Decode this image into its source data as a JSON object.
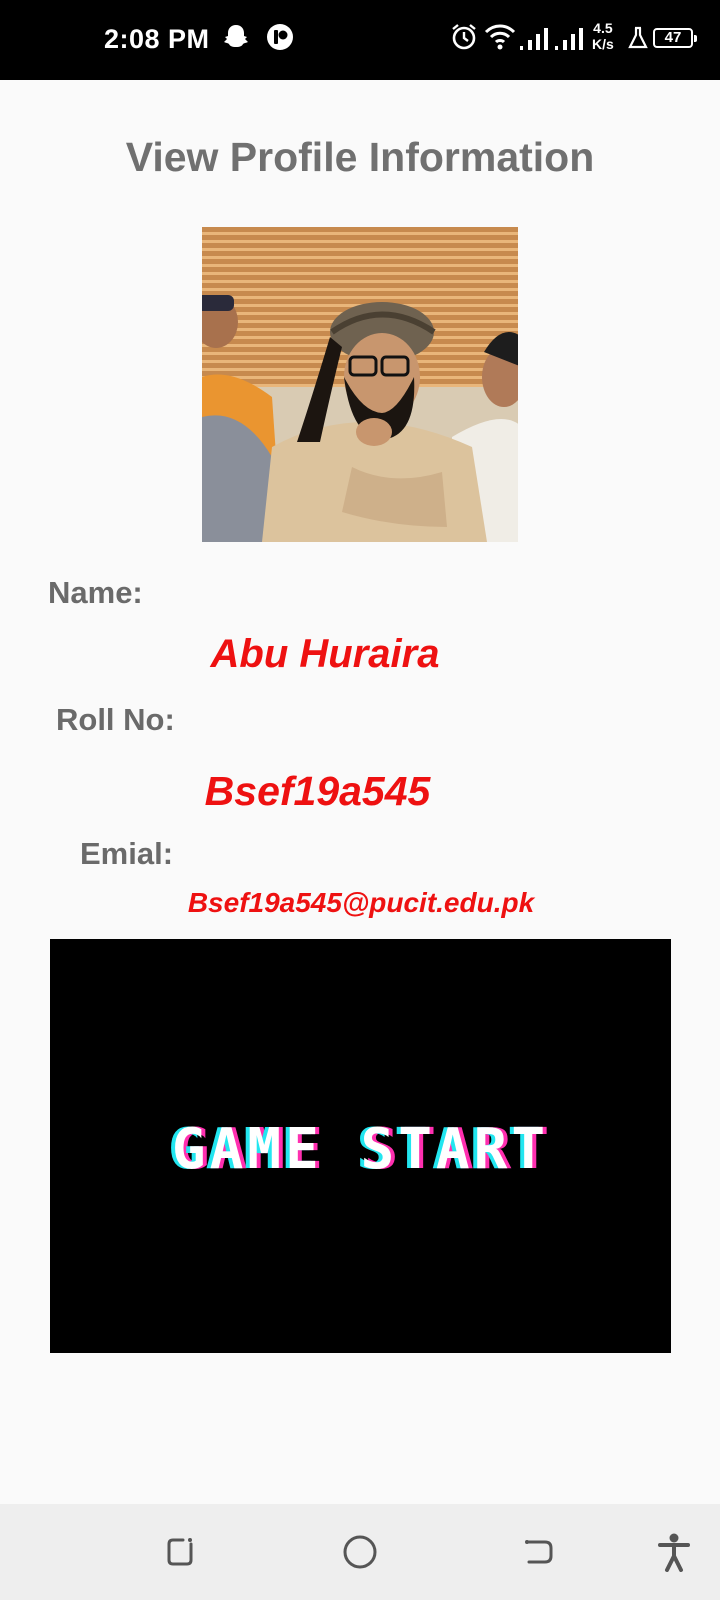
{
  "status_bar": {
    "time": "2:08 PM",
    "speed_value": "4.5",
    "speed_unit": "K/s",
    "battery": "47",
    "icons": [
      "snapchat-icon",
      "app-notification-icon",
      "alarm-icon",
      "wifi-icon",
      "signal-icon",
      "signal-icon",
      "lab-icon",
      "battery-icon"
    ]
  },
  "page": {
    "title": "View Profile Information"
  },
  "profile": {
    "name_label": "Name:",
    "name_value": "Abu Huraira",
    "roll_label": "Roll No:",
    "roll_value": "Bsef19a545",
    "email_label": "Emial:",
    "email_value": "Bsef19a545@pucit.edu.pk"
  },
  "game_banner": {
    "text": "GAME START"
  },
  "nav_bar": {
    "buttons": [
      "recent-apps",
      "home",
      "back",
      "accessibility"
    ]
  },
  "colors": {
    "title": "#707070",
    "label": "#6a6a6a",
    "value_red": "#ee1111",
    "background": "#fafafa",
    "status_bar": "#000000",
    "nav_bar": "#eeeeee"
  }
}
